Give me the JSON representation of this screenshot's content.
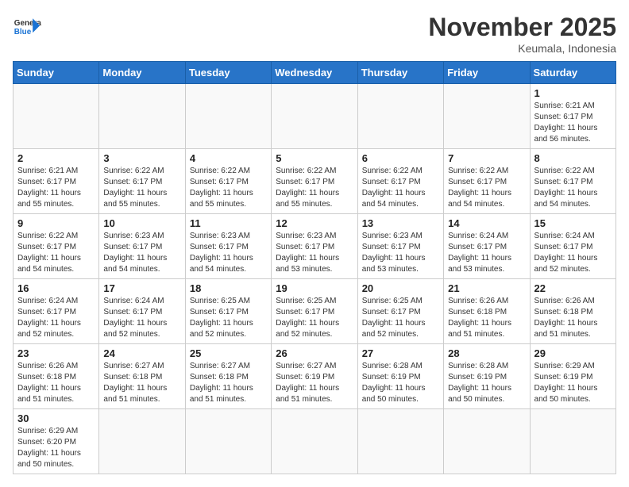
{
  "header": {
    "logo_general": "General",
    "logo_blue": "Blue",
    "title": "November 2025",
    "location": "Keumala, Indonesia"
  },
  "days_of_week": [
    "Sunday",
    "Monday",
    "Tuesday",
    "Wednesday",
    "Thursday",
    "Friday",
    "Saturday"
  ],
  "weeks": [
    [
      {
        "day": "",
        "info": ""
      },
      {
        "day": "",
        "info": ""
      },
      {
        "day": "",
        "info": ""
      },
      {
        "day": "",
        "info": ""
      },
      {
        "day": "",
        "info": ""
      },
      {
        "day": "",
        "info": ""
      },
      {
        "day": "1",
        "info": "Sunrise: 6:21 AM\nSunset: 6:17 PM\nDaylight: 11 hours\nand 56 minutes."
      }
    ],
    [
      {
        "day": "2",
        "info": "Sunrise: 6:21 AM\nSunset: 6:17 PM\nDaylight: 11 hours\nand 55 minutes."
      },
      {
        "day": "3",
        "info": "Sunrise: 6:22 AM\nSunset: 6:17 PM\nDaylight: 11 hours\nand 55 minutes."
      },
      {
        "day": "4",
        "info": "Sunrise: 6:22 AM\nSunset: 6:17 PM\nDaylight: 11 hours\nand 55 minutes."
      },
      {
        "day": "5",
        "info": "Sunrise: 6:22 AM\nSunset: 6:17 PM\nDaylight: 11 hours\nand 55 minutes."
      },
      {
        "day": "6",
        "info": "Sunrise: 6:22 AM\nSunset: 6:17 PM\nDaylight: 11 hours\nand 54 minutes."
      },
      {
        "day": "7",
        "info": "Sunrise: 6:22 AM\nSunset: 6:17 PM\nDaylight: 11 hours\nand 54 minutes."
      },
      {
        "day": "8",
        "info": "Sunrise: 6:22 AM\nSunset: 6:17 PM\nDaylight: 11 hours\nand 54 minutes."
      }
    ],
    [
      {
        "day": "9",
        "info": "Sunrise: 6:22 AM\nSunset: 6:17 PM\nDaylight: 11 hours\nand 54 minutes."
      },
      {
        "day": "10",
        "info": "Sunrise: 6:23 AM\nSunset: 6:17 PM\nDaylight: 11 hours\nand 54 minutes."
      },
      {
        "day": "11",
        "info": "Sunrise: 6:23 AM\nSunset: 6:17 PM\nDaylight: 11 hours\nand 54 minutes."
      },
      {
        "day": "12",
        "info": "Sunrise: 6:23 AM\nSunset: 6:17 PM\nDaylight: 11 hours\nand 53 minutes."
      },
      {
        "day": "13",
        "info": "Sunrise: 6:23 AM\nSunset: 6:17 PM\nDaylight: 11 hours\nand 53 minutes."
      },
      {
        "day": "14",
        "info": "Sunrise: 6:24 AM\nSunset: 6:17 PM\nDaylight: 11 hours\nand 53 minutes."
      },
      {
        "day": "15",
        "info": "Sunrise: 6:24 AM\nSunset: 6:17 PM\nDaylight: 11 hours\nand 52 minutes."
      }
    ],
    [
      {
        "day": "16",
        "info": "Sunrise: 6:24 AM\nSunset: 6:17 PM\nDaylight: 11 hours\nand 52 minutes."
      },
      {
        "day": "17",
        "info": "Sunrise: 6:24 AM\nSunset: 6:17 PM\nDaylight: 11 hours\nand 52 minutes."
      },
      {
        "day": "18",
        "info": "Sunrise: 6:25 AM\nSunset: 6:17 PM\nDaylight: 11 hours\nand 52 minutes."
      },
      {
        "day": "19",
        "info": "Sunrise: 6:25 AM\nSunset: 6:17 PM\nDaylight: 11 hours\nand 52 minutes."
      },
      {
        "day": "20",
        "info": "Sunrise: 6:25 AM\nSunset: 6:17 PM\nDaylight: 11 hours\nand 52 minutes."
      },
      {
        "day": "21",
        "info": "Sunrise: 6:26 AM\nSunset: 6:18 PM\nDaylight: 11 hours\nand 51 minutes."
      },
      {
        "day": "22",
        "info": "Sunrise: 6:26 AM\nSunset: 6:18 PM\nDaylight: 11 hours\nand 51 minutes."
      }
    ],
    [
      {
        "day": "23",
        "info": "Sunrise: 6:26 AM\nSunset: 6:18 PM\nDaylight: 11 hours\nand 51 minutes."
      },
      {
        "day": "24",
        "info": "Sunrise: 6:27 AM\nSunset: 6:18 PM\nDaylight: 11 hours\nand 51 minutes."
      },
      {
        "day": "25",
        "info": "Sunrise: 6:27 AM\nSunset: 6:18 PM\nDaylight: 11 hours\nand 51 minutes."
      },
      {
        "day": "26",
        "info": "Sunrise: 6:27 AM\nSunset: 6:19 PM\nDaylight: 11 hours\nand 51 minutes."
      },
      {
        "day": "27",
        "info": "Sunrise: 6:28 AM\nSunset: 6:19 PM\nDaylight: 11 hours\nand 50 minutes."
      },
      {
        "day": "28",
        "info": "Sunrise: 6:28 AM\nSunset: 6:19 PM\nDaylight: 11 hours\nand 50 minutes."
      },
      {
        "day": "29",
        "info": "Sunrise: 6:29 AM\nSunset: 6:19 PM\nDaylight: 11 hours\nand 50 minutes."
      }
    ],
    [
      {
        "day": "30",
        "info": "Sunrise: 6:29 AM\nSunset: 6:20 PM\nDaylight: 11 hours\nand 50 minutes."
      },
      {
        "day": "",
        "info": ""
      },
      {
        "day": "",
        "info": ""
      },
      {
        "day": "",
        "info": ""
      },
      {
        "day": "",
        "info": ""
      },
      {
        "day": "",
        "info": ""
      },
      {
        "day": "",
        "info": ""
      }
    ]
  ]
}
